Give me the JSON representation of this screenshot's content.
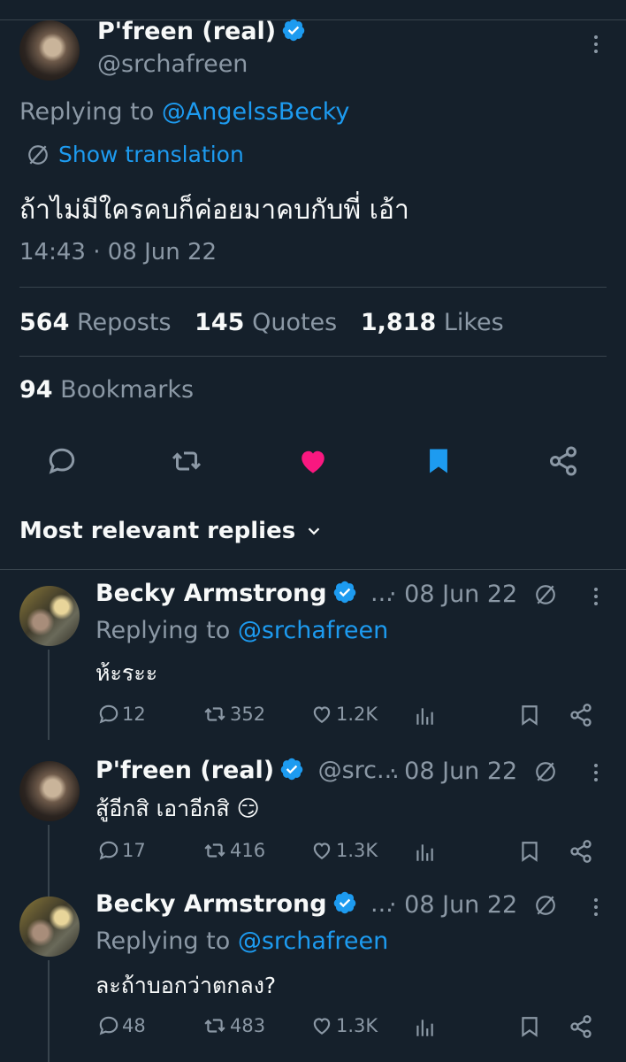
{
  "tweet": {
    "name": "P'freen (real)",
    "handle": "@srchafreen",
    "replying_prefix": "Replying to",
    "replying_to": "@AngelssBecky",
    "show_translation": "Show translation",
    "text": "ถ้าไม่มีใครคบก็ค่อยมาคบกับพี่ เอ้า",
    "timestamp": "14:43 · 08 Jun 22",
    "stats": {
      "reposts_count": "564",
      "reposts_label": "Reposts",
      "quotes_count": "145",
      "quotes_label": "Quotes",
      "likes_count": "1,818",
      "likes_label": "Likes",
      "bookmarks_count": "94",
      "bookmarks_label": "Bookmarks"
    }
  },
  "replies_header": "Most relevant replies",
  "replies": [
    {
      "name": "Becky Armstrong",
      "handle": "...",
      "date": "· 08 Jun 22",
      "replying_prefix": "Replying to",
      "replying_to": "@srchafreen",
      "text": "ห้ะระะ",
      "replies": "12",
      "reposts": "352",
      "likes": "1.2K"
    },
    {
      "name": "P'freen (real)",
      "handle": "@src...",
      "date": "· 08 Jun 22",
      "text": "สู้อีกสิ เอาอีกสิ 😏",
      "replies": "17",
      "reposts": "416",
      "likes": "1.3K"
    },
    {
      "name": "Becky Armstrong",
      "handle": "...",
      "date": "· 08 Jun 22",
      "replying_prefix": "Replying to",
      "replying_to": "@srchafreen",
      "text": "ละถ้าบอกว่าตกลง?",
      "replies": "48",
      "reposts": "483",
      "likes": "1.3K"
    }
  ],
  "colors": {
    "background": "#15202b",
    "accent": "#1d9bf0",
    "like": "#f91880",
    "muted": "#8b98a5"
  }
}
